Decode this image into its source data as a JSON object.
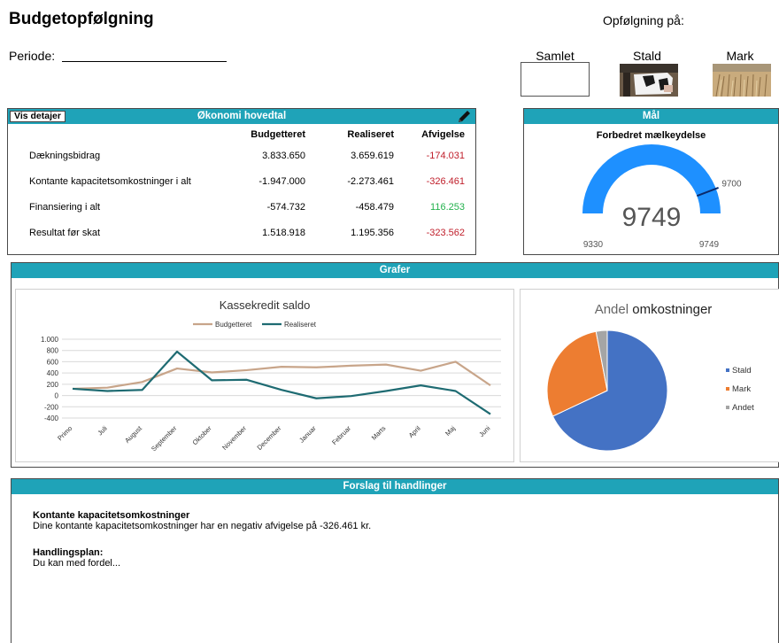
{
  "header": {
    "title": "Budgetopfølgning",
    "opfoelgning_label": "Opfølgning på:",
    "periode_label": "Periode:"
  },
  "options": [
    {
      "label": "Samlet",
      "icon": "blank-box"
    },
    {
      "label": "Stald",
      "icon": "cow-photo"
    },
    {
      "label": "Mark",
      "icon": "field-photo"
    }
  ],
  "okonomi": {
    "title": "Økonomi hovedtal",
    "vis_detaljer": "Vis detajer",
    "headers": [
      "Budgetteret",
      "Realiseret",
      "Afvigelse"
    ],
    "rows": [
      {
        "label": "Dækningsbidrag",
        "budget": "3.833.650",
        "real": "3.659.619",
        "afv": "-174.031",
        "status": "neg"
      },
      {
        "label": "Kontante kapacitetsomkostninger i alt",
        "budget": "-1.947.000",
        "real": "-2.273.461",
        "afv": "-326.461",
        "status": "neg"
      },
      {
        "label": "Finansiering i alt",
        "budget": "-574.732",
        "real": "-458.479",
        "afv": "116.253",
        "status": "pos"
      },
      {
        "label": "Resultat før skat",
        "budget": "1.518.918",
        "real": "1.195.356",
        "afv": "-323.562",
        "status": "neg"
      }
    ]
  },
  "maal": {
    "title": "Mål",
    "subtitle": "Forbedret mælkeydelse",
    "value": 9749,
    "min": 9330,
    "max": 9749,
    "target": 9700,
    "value_label": "9749",
    "min_label": "9330",
    "max_label": "9749",
    "target_label": "9700",
    "color": "#1e90ff"
  },
  "grafer": {
    "title": "Grafer"
  },
  "chart_data": [
    {
      "type": "line",
      "title": "Kassekredit saldo",
      "categories": [
        "Primo",
        "Juli",
        "August",
        "September",
        "Oktober",
        "November",
        "December",
        "Januar",
        "Februar",
        "Marts",
        "April",
        "Maj",
        "Juni"
      ],
      "y_ticks": [
        "1.000",
        "800",
        "600",
        "400",
        "200",
        "0",
        "-200",
        "-400"
      ],
      "ylim": [
        -400,
        1000
      ],
      "grid": true,
      "legend": "top",
      "series": [
        {
          "name": "Budgetteret",
          "color": "#c8a58a",
          "values": [
            120,
            140,
            240,
            480,
            410,
            450,
            510,
            500,
            530,
            550,
            440,
            600,
            180
          ]
        },
        {
          "name": "Realiseret",
          "color": "#1e6b72",
          "values": [
            120,
            80,
            100,
            780,
            270,
            280,
            100,
            -50,
            -10,
            80,
            180,
            80,
            -330
          ]
        }
      ]
    },
    {
      "type": "pie",
      "title_part1": "Andel",
      "title_part2": "omkostninger",
      "legend": "right",
      "slices": [
        {
          "name": "Stald",
          "value": 68,
          "color": "#4472c4"
        },
        {
          "name": "Mark",
          "value": 29,
          "color": "#ed7d31"
        },
        {
          "name": "Andet",
          "value": 3,
          "color": "#a5a5a5"
        }
      ]
    }
  ],
  "forslag": {
    "title": "Forslag til handlinger",
    "heading1": "Kontante kapacitetsomkostninger",
    "text1": "Dine kontante kapacitetsomkostninger har en negativ afvigelse på -326.461 kr.",
    "heading2": "Handlingsplan:",
    "text2": "Du kan med fordel..."
  }
}
